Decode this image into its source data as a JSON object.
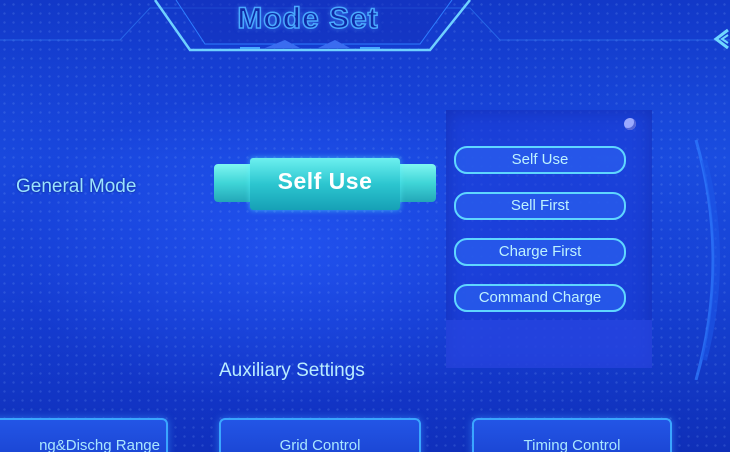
{
  "header": {
    "title": "Mode Set"
  },
  "general_mode": {
    "label": "General Mode",
    "selected_value": "Self Use"
  },
  "mode_dropdown": {
    "options": [
      "Self Use",
      "Sell First",
      "Charge First",
      "Command Charge"
    ]
  },
  "auxiliary": {
    "label": "Auxiliary Settings"
  },
  "bottom_buttons": {
    "range": "ng&Dischg Range",
    "grid": "Grid Control",
    "timing": "Timing Control"
  },
  "colors": {
    "background": "#1744d6",
    "accent_cyan": "#3fd5d7",
    "option_border": "#5fd6ff",
    "text_light": "#9ae3ff"
  }
}
